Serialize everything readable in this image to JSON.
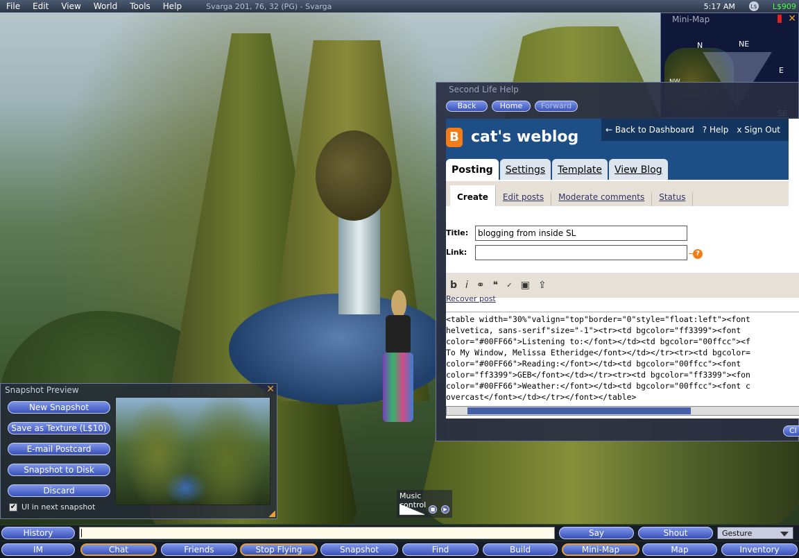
{
  "menubar": {
    "items": [
      "File",
      "Edit",
      "View",
      "World",
      "Tools",
      "Help"
    ],
    "location": "Svarga 201, 76, 32 (PG) - Svarga",
    "time": "5:17 AM",
    "currency_icon": "linden-dollar-icon",
    "balance": "L$909"
  },
  "minimap": {
    "title": "Mini-Map",
    "directions": {
      "n": "N",
      "ne": "NE",
      "e": "E",
      "nw": "NW",
      "se": "SE"
    }
  },
  "help_window": {
    "title": "Second Life Help",
    "back": "Back",
    "home": "Home",
    "forward": "Forward",
    "close": "Cl",
    "blog": {
      "logo": "B",
      "title": "cat's weblog",
      "links": {
        "dashboard": "Back to Dashboard",
        "help": "Help",
        "signout": "Sign Out"
      },
      "tabs": [
        "Posting",
        "Settings",
        "Template",
        "View Blog"
      ],
      "subtabs": [
        "Create",
        "Edit posts",
        "Moderate comments",
        "Status"
      ],
      "title_label": "Title:",
      "title_value": "blogging from inside SL",
      "link_label": "Link:",
      "link_value": "",
      "help_q": "?",
      "toolbar": {
        "bold": "b",
        "italic": "i"
      },
      "recover": "Recover post",
      "code_lines": [
        "<table width=\"30%\"valign=\"top\"border=\"0\"style=\"float:left\"><font",
        "helvetica, sans-serif\"size=\"-1\"><tr><td bgcolor=\"ff3399\"><font",
        "color=\"#00FF66\">Listening to:</font></td><td bgcolor=\"00ffcc\"><f",
        "To My Window, Melissa Etheridge</font></td></tr><tr><td bgcolor=",
        "color=\"#00FF66\">Reading:</font></td><td bgcolor=\"00ffcc\"><font",
        "color=\"ff3399\">GEB</font></td></tr><tr><td bgcolor=\"ff3399\"><fon",
        "color=\"#00FF66\">Weather:</font></td><td bgcolor=\"00ffcc\"><font c",
        "overcast</font></td></tr></font></table>"
      ]
    }
  },
  "snapshot": {
    "title": "Snapshot Preview",
    "buttons": [
      "New Snapshot",
      "Save as Texture (L$10)",
      "E-mail Postcard",
      "Snapshot to Disk",
      "Discard"
    ],
    "ui_checkbox_label": "UI in next snapshot",
    "ui_checked": true
  },
  "music": {
    "title": "Music control"
  },
  "chat": {
    "history": "History",
    "say": "Say",
    "shout": "Shout",
    "gesture": "Gesture",
    "input_value": ""
  },
  "toolbar": [
    "IM",
    "Chat",
    "Friends",
    "Stop Flying",
    "Snapshot",
    "Find",
    "Build",
    "Mini-Map",
    "Map",
    "Inventory"
  ]
}
